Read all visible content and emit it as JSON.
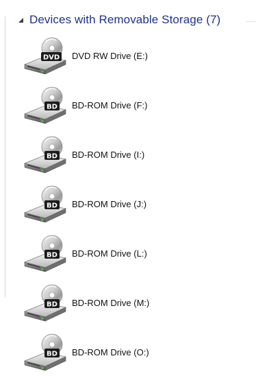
{
  "group": {
    "title": "Devices with Removable Storage (7)"
  },
  "drives": [
    {
      "label": "DVD RW Drive (E:)",
      "badge": "DVD"
    },
    {
      "label": "BD-ROM Drive (F:)",
      "badge": "BD"
    },
    {
      "label": "BD-ROM Drive (I:)",
      "badge": "BD"
    },
    {
      "label": "BD-ROM Drive (J:)",
      "badge": "BD"
    },
    {
      "label": "BD-ROM Drive (L:)",
      "badge": "BD"
    },
    {
      "label": "BD-ROM Drive (M:)",
      "badge": "BD"
    },
    {
      "label": "BD-ROM Drive (O:)",
      "badge": "BD"
    }
  ],
  "colors": {
    "header_text": "#1e3287",
    "led": "#4fd13a"
  },
  "icons": {
    "collapse": "collapse-arrow-icon",
    "drive": "optical-drive-icon"
  }
}
